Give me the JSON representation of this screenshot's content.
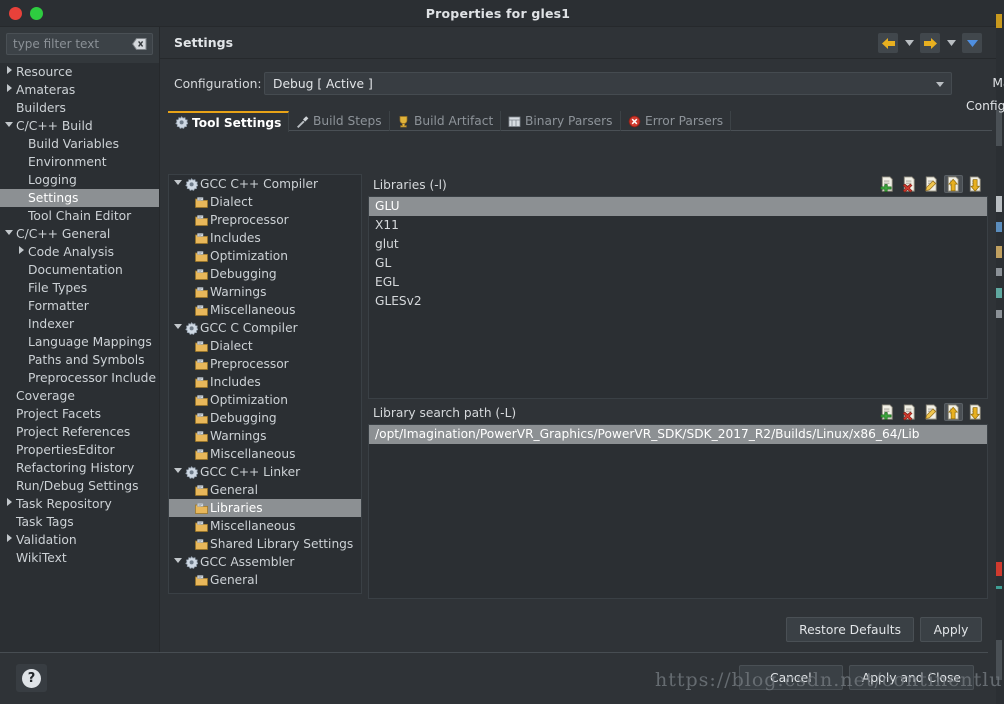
{
  "window": {
    "title": "Properties for gles1",
    "close_label": "close",
    "maximize_label": "maximize"
  },
  "sidebar": {
    "filter": {
      "placeholder": "type filter text",
      "value": "",
      "clear_icon": "clear-icon"
    },
    "items": [
      {
        "label": "Resource",
        "indent": 0,
        "arrow": "collapsed",
        "selected": false
      },
      {
        "label": "Amateras",
        "indent": 0,
        "arrow": "collapsed",
        "selected": false
      },
      {
        "label": "Builders",
        "indent": 0,
        "arrow": "none",
        "selected": false
      },
      {
        "label": "C/C++ Build",
        "indent": 0,
        "arrow": "expanded",
        "selected": false
      },
      {
        "label": "Build Variables",
        "indent": 1,
        "arrow": "none",
        "selected": false
      },
      {
        "label": "Environment",
        "indent": 1,
        "arrow": "none",
        "selected": false
      },
      {
        "label": "Logging",
        "indent": 1,
        "arrow": "none",
        "selected": false
      },
      {
        "label": "Settings",
        "indent": 1,
        "arrow": "none",
        "selected": true
      },
      {
        "label": "Tool Chain Editor",
        "indent": 1,
        "arrow": "none",
        "selected": false
      },
      {
        "label": "C/C++ General",
        "indent": 0,
        "arrow": "expanded",
        "selected": false
      },
      {
        "label": "Code Analysis",
        "indent": 1,
        "arrow": "collapsed",
        "selected": false
      },
      {
        "label": "Documentation",
        "indent": 1,
        "arrow": "none",
        "selected": false
      },
      {
        "label": "File Types",
        "indent": 1,
        "arrow": "none",
        "selected": false
      },
      {
        "label": "Formatter",
        "indent": 1,
        "arrow": "none",
        "selected": false
      },
      {
        "label": "Indexer",
        "indent": 1,
        "arrow": "none",
        "selected": false
      },
      {
        "label": "Language Mappings",
        "indent": 1,
        "arrow": "none",
        "selected": false
      },
      {
        "label": "Paths and Symbols",
        "indent": 1,
        "arrow": "none",
        "selected": false
      },
      {
        "label": "Preprocessor Include",
        "indent": 1,
        "arrow": "none",
        "selected": false
      },
      {
        "label": "Coverage",
        "indent": 0,
        "arrow": "none",
        "selected": false
      },
      {
        "label": "Project Facets",
        "indent": 0,
        "arrow": "none",
        "selected": false
      },
      {
        "label": "Project References",
        "indent": 0,
        "arrow": "none",
        "selected": false
      },
      {
        "label": "PropertiesEditor",
        "indent": 0,
        "arrow": "none",
        "selected": false
      },
      {
        "label": "Refactoring History",
        "indent": 0,
        "arrow": "none",
        "selected": false
      },
      {
        "label": "Run/Debug Settings",
        "indent": 0,
        "arrow": "none",
        "selected": false
      },
      {
        "label": "Task Repository",
        "indent": 0,
        "arrow": "collapsed",
        "selected": false
      },
      {
        "label": "Task Tags",
        "indent": 0,
        "arrow": "none",
        "selected": false
      },
      {
        "label": "Validation",
        "indent": 0,
        "arrow": "collapsed",
        "selected": false
      },
      {
        "label": "WikiText",
        "indent": 0,
        "arrow": "none",
        "selected": false
      }
    ]
  },
  "page": {
    "title": "Settings",
    "nav": {
      "back_icon": "back-arrow-icon",
      "back_menu_icon": "chevron-down-icon",
      "forward_icon": "forward-arrow-icon",
      "forward_menu_icon": "chevron-down-icon",
      "view_menu_icon": "chevron-down-icon"
    },
    "configuration": {
      "label": "Configuration:",
      "value": "Debug  [ Active ]",
      "manage_label": "Manage Configurations...",
      "caret_icon": "chevron-down-icon"
    },
    "tabs": [
      {
        "label": "Tool Settings",
        "icon": "tool-settings-icon",
        "active": true
      },
      {
        "label": "Build Steps",
        "icon": "build-steps-icon",
        "active": false
      },
      {
        "label": "Build Artifact",
        "icon": "build-artifact-icon",
        "active": false
      },
      {
        "label": "Binary Parsers",
        "icon": "binary-parsers-icon",
        "active": false
      },
      {
        "label": "Error Parsers",
        "icon": "error-parsers-icon",
        "active": false
      }
    ]
  },
  "tool_tree": [
    {
      "label": "GCC C++ Compiler",
      "indent": 0,
      "arrow": "expanded",
      "icon": "compiler-icon",
      "selected": false
    },
    {
      "label": "Dialect",
      "indent": 1,
      "arrow": "none",
      "icon": "option-folder-icon",
      "selected": false
    },
    {
      "label": "Preprocessor",
      "indent": 1,
      "arrow": "none",
      "icon": "option-folder-icon",
      "selected": false
    },
    {
      "label": "Includes",
      "indent": 1,
      "arrow": "none",
      "icon": "option-folder-icon",
      "selected": false
    },
    {
      "label": "Optimization",
      "indent": 1,
      "arrow": "none",
      "icon": "option-folder-icon",
      "selected": false
    },
    {
      "label": "Debugging",
      "indent": 1,
      "arrow": "none",
      "icon": "option-folder-icon",
      "selected": false
    },
    {
      "label": "Warnings",
      "indent": 1,
      "arrow": "none",
      "icon": "option-folder-icon",
      "selected": false
    },
    {
      "label": "Miscellaneous",
      "indent": 1,
      "arrow": "none",
      "icon": "option-folder-icon",
      "selected": false
    },
    {
      "label": "GCC C Compiler",
      "indent": 0,
      "arrow": "expanded",
      "icon": "compiler-icon",
      "selected": false
    },
    {
      "label": "Dialect",
      "indent": 1,
      "arrow": "none",
      "icon": "option-folder-icon",
      "selected": false
    },
    {
      "label": "Preprocessor",
      "indent": 1,
      "arrow": "none",
      "icon": "option-folder-icon",
      "selected": false
    },
    {
      "label": "Includes",
      "indent": 1,
      "arrow": "none",
      "icon": "option-folder-icon",
      "selected": false
    },
    {
      "label": "Optimization",
      "indent": 1,
      "arrow": "none",
      "icon": "option-folder-icon",
      "selected": false
    },
    {
      "label": "Debugging",
      "indent": 1,
      "arrow": "none",
      "icon": "option-folder-icon",
      "selected": false
    },
    {
      "label": "Warnings",
      "indent": 1,
      "arrow": "none",
      "icon": "option-folder-icon",
      "selected": false
    },
    {
      "label": "Miscellaneous",
      "indent": 1,
      "arrow": "none",
      "icon": "option-folder-icon",
      "selected": false
    },
    {
      "label": "GCC C++ Linker",
      "indent": 0,
      "arrow": "expanded",
      "icon": "linker-icon",
      "selected": false
    },
    {
      "label": "General",
      "indent": 1,
      "arrow": "none",
      "icon": "option-folder-icon",
      "selected": false
    },
    {
      "label": "Libraries",
      "indent": 1,
      "arrow": "none",
      "icon": "option-folder-icon",
      "selected": true
    },
    {
      "label": "Miscellaneous",
      "indent": 1,
      "arrow": "none",
      "icon": "option-folder-icon",
      "selected": false
    },
    {
      "label": "Shared Library Settings",
      "indent": 1,
      "arrow": "none",
      "icon": "option-folder-icon",
      "selected": false
    },
    {
      "label": "GCC Assembler",
      "indent": 0,
      "arrow": "expanded",
      "icon": "assembler-icon",
      "selected": false
    },
    {
      "label": "General",
      "indent": 1,
      "arrow": "none",
      "icon": "option-folder-icon",
      "selected": false
    }
  ],
  "libraries_section": {
    "title": "Libraries (-l)",
    "tools": [
      {
        "icon": "add-icon",
        "name": "add"
      },
      {
        "icon": "delete-icon",
        "name": "delete"
      },
      {
        "icon": "edit-icon",
        "name": "edit"
      },
      {
        "icon": "move-up-icon",
        "name": "move-up"
      },
      {
        "icon": "move-down-icon",
        "name": "move-down"
      }
    ],
    "entries": [
      {
        "value": "GLU",
        "selected": true
      },
      {
        "value": "X11",
        "selected": false
      },
      {
        "value": "glut",
        "selected": false
      },
      {
        "value": "GL",
        "selected": false
      },
      {
        "value": "EGL",
        "selected": false
      },
      {
        "value": "GLESv2",
        "selected": false
      }
    ]
  },
  "search_path_section": {
    "title": "Library search path (-L)",
    "tools": [
      {
        "icon": "add-icon",
        "name": "add"
      },
      {
        "icon": "delete-icon",
        "name": "delete"
      },
      {
        "icon": "edit-icon",
        "name": "edit"
      },
      {
        "icon": "move-up-icon",
        "name": "move-up"
      },
      {
        "icon": "move-down-icon",
        "name": "move-down"
      }
    ],
    "entries": [
      {
        "value": "/opt/Imagination/PowerVR_Graphics/PowerVR_SDK/SDK_2017_R2/Builds/Linux/x86_64/Lib",
        "selected": true
      }
    ]
  },
  "buttons": {
    "restore_defaults": "Restore Defaults",
    "apply": "Apply",
    "cancel": "Cancel",
    "apply_and_close": "Apply and Close",
    "help_icon": "help-icon",
    "help_glyph": "?"
  },
  "watermark": "https://blog.csdn.net/continentlu",
  "colors": {
    "dialog_bg": "#2f3337",
    "pane_bg": "#2b2f33",
    "selection": "#8c9093",
    "accent_tab": "#e8a317",
    "nav_arrow": "#e8b020",
    "close_btn": "#e8413a",
    "max_btn": "#2ecc40"
  }
}
